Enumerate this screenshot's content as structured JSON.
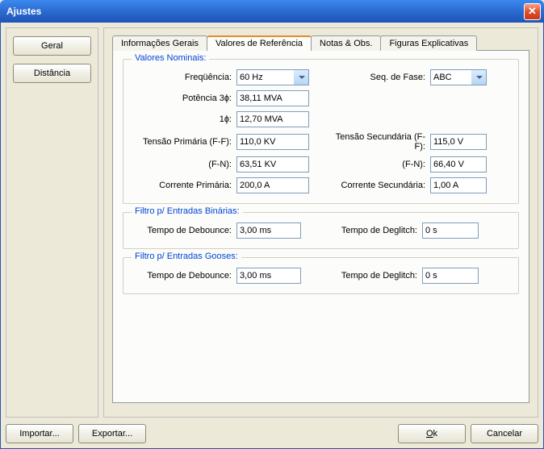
{
  "window": {
    "title": "Ajustes"
  },
  "leftPanel": {
    "items": [
      {
        "label": "Geral"
      },
      {
        "label": "Distância"
      }
    ]
  },
  "tabs": [
    {
      "label": "Informações Gerais"
    },
    {
      "label": "Valores de Referência"
    },
    {
      "label": "Notas & Obs."
    },
    {
      "label": "Figuras Explicativas"
    }
  ],
  "groups": {
    "nominais": {
      "title": "Valores Nominais:",
      "frequencia": {
        "label": "Freqüência:",
        "value": "60 Hz"
      },
      "seqfase": {
        "label": "Seq. de Fase:",
        "value": "ABC"
      },
      "potencia3f": {
        "label": "Potência 3ɸ:",
        "value": "38,11 MVA"
      },
      "potencia1f": {
        "label": "1ɸ:",
        "value": "12,70 MVA"
      },
      "tensaoPrimFF": {
        "label": "Tensão Primária (F-F):",
        "value": "110,0 KV"
      },
      "tensaoSecFF": {
        "label": "Tensão Secundária (F-F):",
        "value": "115,0 V"
      },
      "tensaoPrimFN": {
        "label": "(F-N):",
        "value": "63,51 KV"
      },
      "tensaoSecFN": {
        "label": "(F-N):",
        "value": "66,40 V"
      },
      "correntePrim": {
        "label": "Corrente Primária:",
        "value": "200,0 A"
      },
      "correnteSec": {
        "label": "Corrente Secundária:",
        "value": "1,00 A"
      }
    },
    "binarias": {
      "title": "Filtro p/ Entradas Binárias:",
      "debounce": {
        "label": "Tempo de Debounce:",
        "value": "3,00 ms"
      },
      "deglitch": {
        "label": "Tempo de Deglitch:",
        "value": "0 s"
      }
    },
    "gooses": {
      "title": "Filtro p/ Entradas Gooses:",
      "debounce": {
        "label": "Tempo de Debounce:",
        "value": "3,00 ms"
      },
      "deglitch": {
        "label": "Tempo de Deglitch:",
        "value": "0 s"
      }
    }
  },
  "buttons": {
    "importar": "Importar...",
    "exportar": "Exportar...",
    "ok": "Ok",
    "cancelar": "Cancelar"
  }
}
